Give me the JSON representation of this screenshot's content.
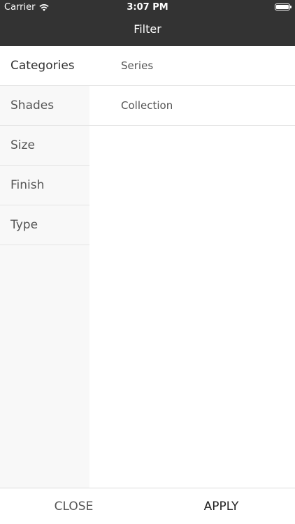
{
  "status_bar": {
    "carrier": "Carrier",
    "time": "3:07 PM"
  },
  "nav": {
    "title": "Filter"
  },
  "sidebar": {
    "items": [
      {
        "label": "Categories",
        "active": true
      },
      {
        "label": "Shades",
        "active": false
      },
      {
        "label": "Size",
        "active": false
      },
      {
        "label": "Finish",
        "active": false
      },
      {
        "label": "Type",
        "active": false
      }
    ]
  },
  "options": {
    "items": [
      {
        "label": "Series"
      },
      {
        "label": "Collection"
      }
    ]
  },
  "footer": {
    "close_label": "CLOSE",
    "apply_label": "APPLY"
  },
  "colors": {
    "header_bg": "#333333",
    "sidebar_bg": "#f8f8f8",
    "divider": "#e4e4e4"
  },
  "icons": {
    "wifi": "wifi-icon",
    "battery": "battery-icon"
  }
}
